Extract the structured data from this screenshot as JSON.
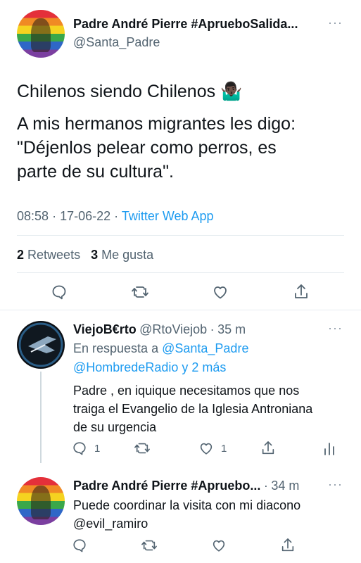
{
  "main_tweet": {
    "author_name": "Padre André Pierre #ApruebоSalida...",
    "author_handle": "@Santa_Padre",
    "line1": "Chilenos siendo Chilenos 🤷🏿‍♂️",
    "line2": "A mis hermanos migrantes les digo:",
    "line3": "\"Déjenlos pelear como perros, es",
    "line4": "parte de su cultura\".",
    "time": "08:58",
    "date": "17-06-22",
    "source": "Twitter Web App",
    "retweets_count": "2",
    "retweets_label": "Retweets",
    "likes_count": "3",
    "likes_label": "Me gusta"
  },
  "reply1": {
    "author_name": "ViejoB€rto",
    "author_handle": "@RtoViejob",
    "time_ago": "35 m",
    "replying_label": "En respuesta a",
    "replying_to1": "@Santa_Padre",
    "replying_to2": "@HombredeRadio",
    "replying_more": "y 2 más",
    "text1": "Padre , en iquique necesitamos que nos",
    "text2": "traiga el Evangelio de la Iglesia Antroniana",
    "text3": "de su urgencia",
    "reply_count": "1",
    "like_count": "1"
  },
  "reply2": {
    "author_name": "Padre André Pierre #Apruebo...",
    "time_ago": "34 m",
    "text1": "Puede coordinar la visita con mi diacono",
    "mention": "@evil_ramiro"
  },
  "colors": {
    "accent": "#1d9bf0",
    "text": "#0f1419",
    "muted": "#536471"
  },
  "icons": [
    "more-icon",
    "reply-icon",
    "retweet-icon",
    "like-icon",
    "share-icon",
    "analytics-icon"
  ]
}
